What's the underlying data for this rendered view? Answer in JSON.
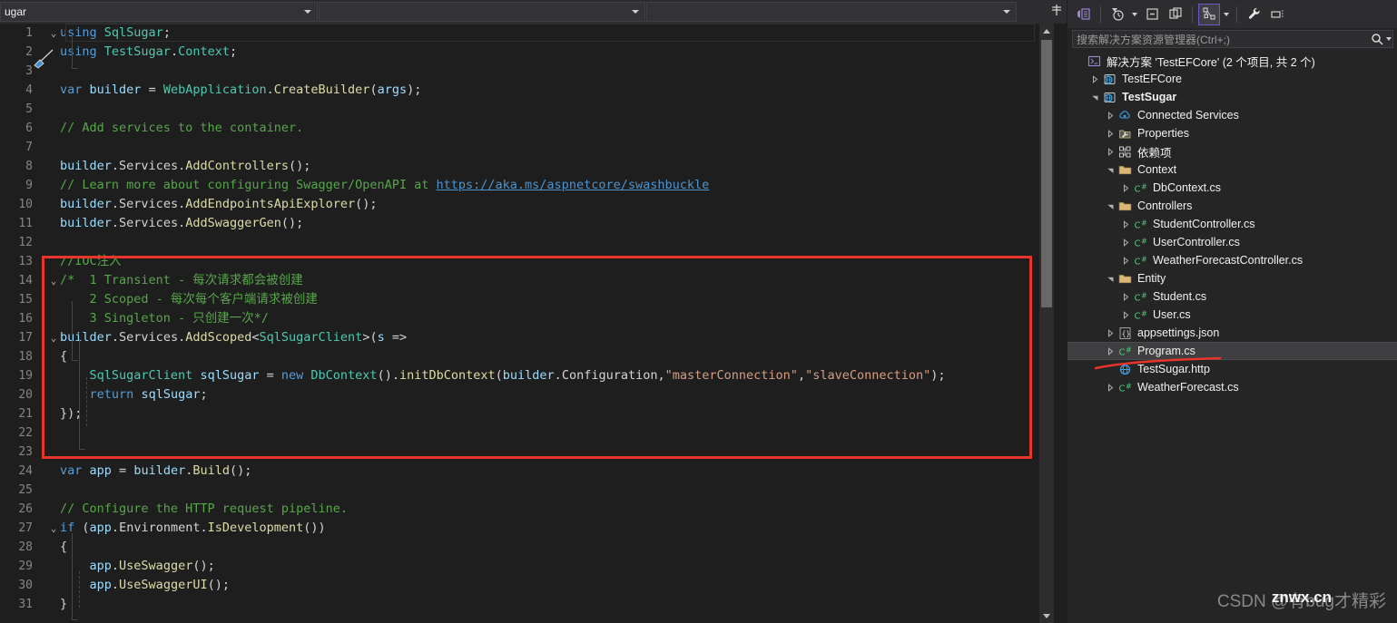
{
  "navbar": {
    "combo1_value": "ugar",
    "combo2_value": "",
    "combo3_value": "",
    "split_icon": "split-window-icon"
  },
  "editor": {
    "filename_fragment": "ugar",
    "lines": [
      {
        "num": "1",
        "fold": "v",
        "text": "using SqlSugar;"
      },
      {
        "num": "2",
        "fold": "",
        "text": "using TestSugar.Context;"
      },
      {
        "num": "3",
        "fold": "",
        "text": ""
      },
      {
        "num": "4",
        "fold": "",
        "text": "var builder = WebApplication.CreateBuilder(args);"
      },
      {
        "num": "5",
        "fold": "",
        "text": ""
      },
      {
        "num": "6",
        "fold": "",
        "text": "// Add services to the container."
      },
      {
        "num": "7",
        "fold": "",
        "text": ""
      },
      {
        "num": "8",
        "fold": "",
        "text": "builder.Services.AddControllers();"
      },
      {
        "num": "9",
        "fold": "",
        "text": "// Learn more about configuring Swagger/OpenAPI at https://aka.ms/aspnetcore/swashbuckle"
      },
      {
        "num": "10",
        "fold": "",
        "text": "builder.Services.AddEndpointsApiExplorer();"
      },
      {
        "num": "11",
        "fold": "",
        "text": "builder.Services.AddSwaggerGen();"
      },
      {
        "num": "12",
        "fold": "",
        "text": ""
      },
      {
        "num": "13",
        "fold": "",
        "text": "//IOC注入"
      },
      {
        "num": "14",
        "fold": "v",
        "text": "/*  1 Transient - 每次请求都会被创建"
      },
      {
        "num": "15",
        "fold": "",
        "text": "    2 Scoped - 每次每个客户端请求被创建"
      },
      {
        "num": "16",
        "fold": "",
        "text": "    3 Singleton - 只创建一次*/"
      },
      {
        "num": "17",
        "fold": "v",
        "text": "builder.Services.AddScoped<SqlSugarClient>(s =>"
      },
      {
        "num": "18",
        "fold": "",
        "text": "{"
      },
      {
        "num": "19",
        "fold": "",
        "text": "    SqlSugarClient sqlSugar = new DbContext().initDbContext(builder.Configuration,\"masterConnection\",\"slaveConnection\");"
      },
      {
        "num": "20",
        "fold": "",
        "text": "    return sqlSugar;"
      },
      {
        "num": "21",
        "fold": "",
        "text": "});"
      },
      {
        "num": "22",
        "fold": "",
        "text": ""
      },
      {
        "num": "23",
        "fold": "",
        "text": ""
      },
      {
        "num": "24",
        "fold": "",
        "text": "var app = builder.Build();"
      },
      {
        "num": "25",
        "fold": "",
        "text": ""
      },
      {
        "num": "26",
        "fold": "",
        "text": "// Configure the HTTP request pipeline."
      },
      {
        "num": "27",
        "fold": "v",
        "text": "if (app.Environment.IsDevelopment())"
      },
      {
        "num": "28",
        "fold": "",
        "text": "{"
      },
      {
        "num": "29",
        "fold": "",
        "text": "    app.UseSwagger();"
      },
      {
        "num": "30",
        "fold": "",
        "text": "    app.UseSwaggerUI();"
      },
      {
        "num": "31",
        "fold": "",
        "text": "}"
      }
    ],
    "annotation_box_color": "#e8342a"
  },
  "solution_explorer": {
    "toolbar": [
      {
        "name": "home-view-icon",
        "glyph": "home"
      },
      {
        "name": "pending-changes-icon",
        "glyph": "clock"
      },
      {
        "name": "collapse-all-icon",
        "glyph": "collapse"
      },
      {
        "name": "show-all-files-icon",
        "glyph": "copies"
      },
      {
        "name": "view-class-view-icon",
        "glyph": "nodes"
      },
      {
        "name": "properties-icon",
        "glyph": "wrench"
      },
      {
        "name": "preview-selected-items-icon",
        "glyph": "preview"
      }
    ],
    "search_placeholder": "搜索解决方案资源管理器(Ctrl+;)",
    "search_value": "",
    "tree": [
      {
        "indent": 0,
        "expander": "none",
        "icon": "solution-icon",
        "label": "解决方案 'TestEFCore' (2 个项目, 共 2 个)",
        "bold": false,
        "selected": false
      },
      {
        "indent": 1,
        "expander": "collapsed",
        "icon": "project-web-icon",
        "label": "TestEFCore",
        "bold": false,
        "selected": false
      },
      {
        "indent": 1,
        "expander": "expanded",
        "icon": "project-web-icon",
        "label": "TestSugar",
        "bold": true,
        "selected": false
      },
      {
        "indent": 2,
        "expander": "collapsed",
        "icon": "connected-services-icon",
        "label": "Connected Services",
        "bold": false,
        "selected": false
      },
      {
        "indent": 2,
        "expander": "collapsed",
        "icon": "properties-folder-icon",
        "label": "Properties",
        "bold": false,
        "selected": false
      },
      {
        "indent": 2,
        "expander": "collapsed",
        "icon": "dependencies-icon",
        "label": "依赖项",
        "bold": false,
        "selected": false
      },
      {
        "indent": 2,
        "expander": "expanded",
        "icon": "folder-icon",
        "label": "Context",
        "bold": false,
        "selected": false
      },
      {
        "indent": 3,
        "expander": "collapsed",
        "icon": "csharp-file-icon",
        "label": "DbContext.cs",
        "bold": false,
        "selected": false
      },
      {
        "indent": 2,
        "expander": "expanded",
        "icon": "folder-icon",
        "label": "Controllers",
        "bold": false,
        "selected": false
      },
      {
        "indent": 3,
        "expander": "collapsed",
        "icon": "csharp-file-icon",
        "label": "StudentController.cs",
        "bold": false,
        "selected": false
      },
      {
        "indent": 3,
        "expander": "collapsed",
        "icon": "csharp-file-icon",
        "label": "UserController.cs",
        "bold": false,
        "selected": false
      },
      {
        "indent": 3,
        "expander": "collapsed",
        "icon": "csharp-file-icon",
        "label": "WeatherForecastController.cs",
        "bold": false,
        "selected": false
      },
      {
        "indent": 2,
        "expander": "expanded",
        "icon": "folder-icon",
        "label": "Entity",
        "bold": false,
        "selected": false
      },
      {
        "indent": 3,
        "expander": "collapsed",
        "icon": "csharp-file-icon",
        "label": "Student.cs",
        "bold": false,
        "selected": false
      },
      {
        "indent": 3,
        "expander": "collapsed",
        "icon": "csharp-file-icon",
        "label": "User.cs",
        "bold": false,
        "selected": false
      },
      {
        "indent": 2,
        "expander": "collapsed",
        "icon": "json-file-icon",
        "label": "appsettings.json",
        "bold": false,
        "selected": false
      },
      {
        "indent": 2,
        "expander": "collapsed",
        "icon": "csharp-file-icon",
        "label": "Program.cs",
        "bold": false,
        "selected": true
      },
      {
        "indent": 2,
        "expander": "none",
        "icon": "http-file-icon",
        "label": "TestSugar.http",
        "bold": false,
        "selected": false
      },
      {
        "indent": 2,
        "expander": "collapsed",
        "icon": "csharp-file-icon",
        "label": "WeatherForecast.cs",
        "bold": false,
        "selected": false
      }
    ],
    "annotation_underline_color": "#e8342a",
    "annotation_underline_target": "Program.cs"
  },
  "watermark": {
    "text": "CSDN @有bug才精彩",
    "overlay_text": "znwx.cn"
  },
  "colors": {
    "editor_background": "#1e1e1e",
    "panel_background": "#252526",
    "toolbar_background": "#2d2d30",
    "accent_red": "#e8342a",
    "keyword_blue": "#569cd6",
    "comment_green": "#57a64a",
    "string_orange": "#d69d85",
    "type_teal": "#4ec9b0",
    "method_yellow": "#dcdcaa",
    "selection_gray": "#3f3f41"
  }
}
